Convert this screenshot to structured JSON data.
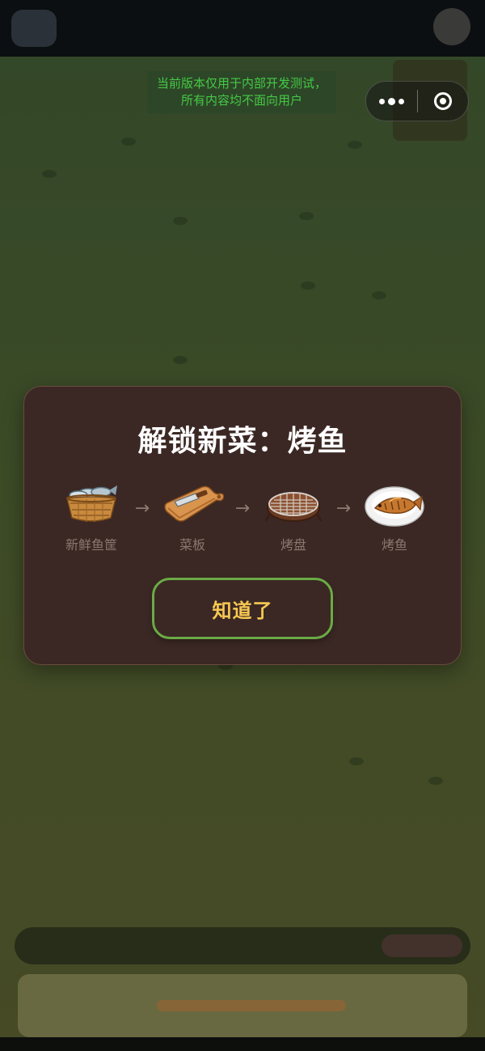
{
  "notice": {
    "line1": "当前版本仅用于内部开发测试，",
    "line2": "所有内容均不面向用户"
  },
  "modal": {
    "title": "解锁新菜：烤鱼",
    "steps": [
      {
        "label": "新鲜鱼筐",
        "icon": "fish-basket-icon"
      },
      {
        "label": "菜板",
        "icon": "cutting-board-icon"
      },
      {
        "label": "烤盘",
        "icon": "grill-pan-icon"
      },
      {
        "label": "烤鱼",
        "icon": "grilled-fish-icon"
      }
    ],
    "arrow": "→",
    "button_label": "知道了"
  },
  "colors": {
    "modal_bg": "#3b2824",
    "button_border": "#6bab45",
    "button_text": "#f7c852",
    "notice_text": "#45c945"
  }
}
